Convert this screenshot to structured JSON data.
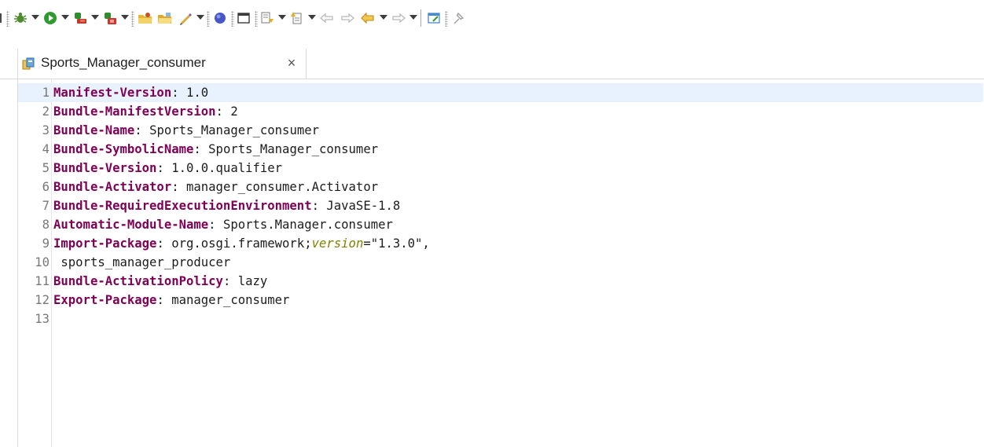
{
  "toolbar": {
    "icons": [
      "debug-icon",
      "run-icon",
      "external-tools-icon",
      "coverage-icon",
      "open-folder-icon",
      "open-task-icon",
      "pen-icon",
      "breakpoint-icon",
      "window-icon",
      "next-annotation-icon",
      "previous-annotation-icon",
      "back-history-icon",
      "forward-history-icon",
      "back-icon",
      "forward-icon",
      "notes-icon",
      "pin-icon"
    ]
  },
  "editor": {
    "tab_title": "Sports_Manager_consumer",
    "close_glyph": "×",
    "lines": [
      {
        "n": "1",
        "key": "Manifest-Version",
        "sep": ": ",
        "value": "1.0"
      },
      {
        "n": "2",
        "key": "Bundle-ManifestVersion",
        "sep": ": ",
        "value": "2"
      },
      {
        "n": "3",
        "key": "Bundle-Name",
        "sep": ": ",
        "value": "Sports_Manager_consumer"
      },
      {
        "n": "4",
        "key": "Bundle-SymbolicName",
        "sep": ": ",
        "value": "Sports_Manager_consumer"
      },
      {
        "n": "5",
        "key": "Bundle-Version",
        "sep": ": ",
        "value": "1.0.0.qualifier"
      },
      {
        "n": "6",
        "key": "Bundle-Activator",
        "sep": ": ",
        "value": "manager_consumer.Activator"
      },
      {
        "n": "7",
        "key": "Bundle-RequiredExecutionEnvironment",
        "sep": ": ",
        "value": "JavaSE-1.8"
      },
      {
        "n": "8",
        "key": "Automatic-Module-Name",
        "sep": ": ",
        "value": "Sports.Manager.consumer"
      },
      {
        "n": "9",
        "key": "Import-Package",
        "sep": ": ",
        "value": "org.osgi.framework;",
        "attr": "version",
        "attr_sep": "=",
        "attr_value": "\"1.3.0\","
      },
      {
        "n": "10",
        "key": "",
        "sep": "",
        "value": " sports_manager_producer"
      },
      {
        "n": "11",
        "key": "Bundle-ActivationPolicy",
        "sep": ": ",
        "value": "lazy"
      },
      {
        "n": "12",
        "key": "Export-Package",
        "sep": ": ",
        "value": "manager_consumer"
      },
      {
        "n": "13",
        "key": "",
        "sep": "",
        "value": ""
      }
    ]
  },
  "colors": {
    "keyword": "#7f0055",
    "attribute": "#808000",
    "current_line": "#e8f2fe"
  }
}
